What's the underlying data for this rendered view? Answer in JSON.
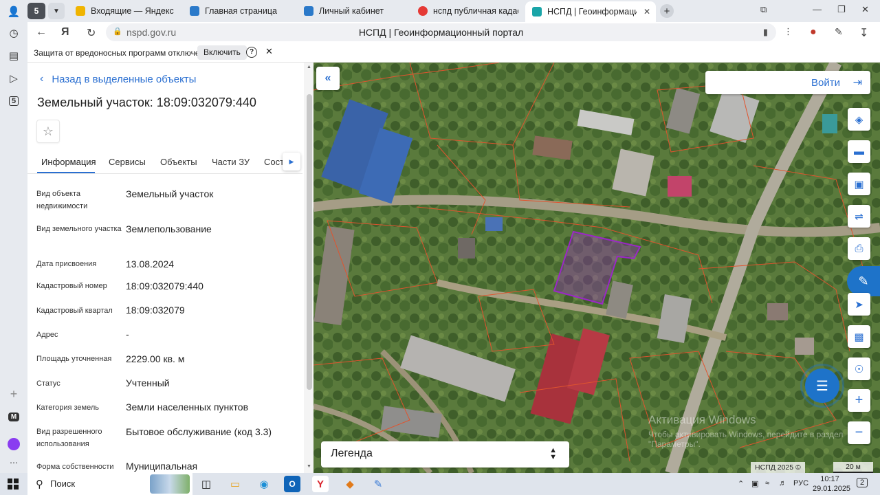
{
  "browser": {
    "tab_counter": "5",
    "tabs": [
      {
        "title": "Входящие — Яндекс Почта",
        "favicon_color": "#f0b400"
      },
      {
        "title": "Главная страница",
        "favicon_color": "#2a79c9"
      },
      {
        "title": "Личный кабинет",
        "favicon_color": "#2a79c9"
      },
      {
        "title": "нспд публичная кадастровая карта",
        "favicon_color": "#e53935"
      },
      {
        "title": "НСПД | Геоинформационный портал",
        "favicon_color": "#1aa5a8"
      }
    ],
    "url": "nspd.gov.ru",
    "page_title": "НСПД | Геоинформационный портал",
    "side_badge": "5",
    "side_letter": "M",
    "security_warning": "Защита от вредоносных программ отключена",
    "security_enable_label": "Включить",
    "help_label": "?",
    "close_label": "✕"
  },
  "panel": {
    "back_label": "Назад в выделенные объекты",
    "title": "Земельный участок: 18:09:032079:440",
    "tabs": [
      "Информация",
      "Сервисы",
      "Объекты",
      "Части ЗУ",
      "Состав"
    ],
    "rows": [
      {
        "label": "Вид объекта недвижимости",
        "value": "Земельный участок"
      },
      {
        "label": "Вид земельного участка",
        "value": "Землепользование"
      },
      {
        "label": "Дата присвоения",
        "value": "13.08.2024"
      },
      {
        "label": "Кадастровый номер",
        "value": "18:09:032079:440"
      },
      {
        "label": "Кадастровый квартал",
        "value": "18:09:032079"
      },
      {
        "label": "Адрес",
        "value": "-"
      },
      {
        "label": "Площадь уточненная",
        "value": "2229.00 кв. м"
      },
      {
        "label": "Статус",
        "value": "Учтенный"
      },
      {
        "label": "Категория земель",
        "value": "Земли населенных пунктов"
      },
      {
        "label": "Вид разрешенного использования",
        "value": "Бытовое обслуживание (код 3.3)"
      },
      {
        "label": "Форма собственности",
        "value": "Муниципальная"
      }
    ]
  },
  "map": {
    "login_label": "Войти",
    "legend_label": "Легенда",
    "attribution": "НСПД 2025 ©",
    "scale_label": "20 м",
    "watermark_title": "Активация Windows",
    "watermark_text": "Чтобы активировать Windows, перейдите в раздел \"Параметры\".",
    "parcel_color": "#9b27c7",
    "boundary_color": "#e0542e"
  },
  "taskbar": {
    "search_label": "Поиск",
    "lang": "РУС",
    "time": "10:17",
    "date": "29.01.2025",
    "notification_count": "2"
  }
}
